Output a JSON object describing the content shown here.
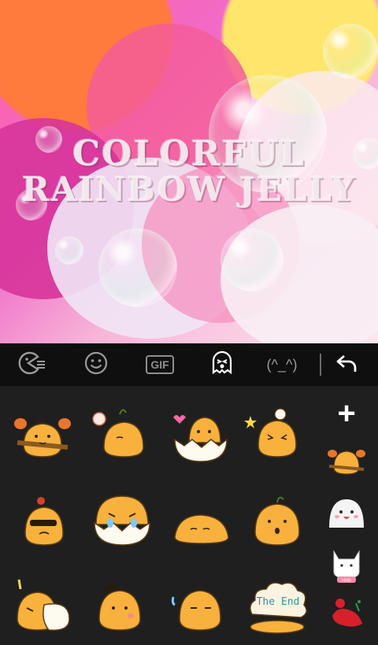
{
  "banner": {
    "title_line1": "COLORFUL",
    "title_line2": "RAINBOW JELLY"
  },
  "toolbar": {
    "items": [
      {
        "id": "pacman",
        "icon": "pacman-menu-icon"
      },
      {
        "id": "emoji",
        "icon": "smiley-icon"
      },
      {
        "id": "gif",
        "label": "GIF"
      },
      {
        "id": "sticker",
        "icon": "ghost-sticker-icon",
        "active": true
      },
      {
        "id": "kaomoji",
        "label": "(^_^)"
      },
      {
        "id": "back",
        "icon": "return-arrow-icon"
      }
    ]
  },
  "stickers": {
    "last_label": "The End",
    "side_tag": "Hello"
  },
  "colors": {
    "toolbar_bg": "#0f0f0f",
    "panel_bg": "#1f1f1f",
    "sticker_orange": "#f7b13c",
    "active_icon": "#ffffff",
    "inactive_icon": "#9a9a9a"
  }
}
